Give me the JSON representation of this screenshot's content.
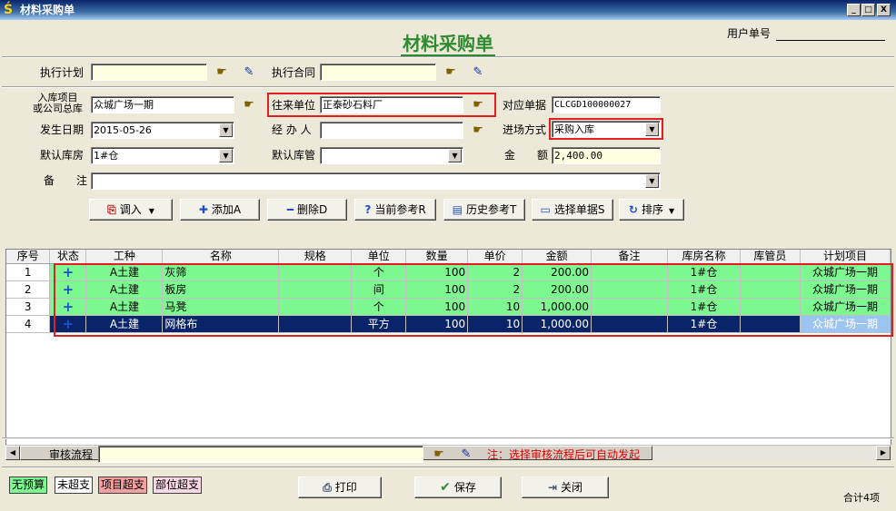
{
  "window": {
    "title": "材料采购单",
    "min": "_",
    "max": "□",
    "close": "X"
  },
  "heading": "材料采购单",
  "user_no_label": "用户单号",
  "row1": {
    "plan_label": "执行计划",
    "plan_value": "",
    "contract_label": "执行合同",
    "contract_value": ""
  },
  "fields": {
    "project_label": "入库项目\n或公司总库",
    "project_value": "众城广场一期",
    "partner_label": "往来单位",
    "partner_value": "正泰砂石料厂",
    "docno_label": "对应单据",
    "docno_value": "CLCGD100000027",
    "date_label": "发生日期",
    "date_value": "2015-05-26",
    "handler_label": "经 办 人",
    "handler_value": "",
    "mode_label": "进场方式",
    "mode_value": "采购入库",
    "warehouse_label": "默认库房",
    "warehouse_value": "1#仓",
    "keeper_label": "默认库管",
    "keeper_value": "",
    "amount_label": "金　　额",
    "amount_value": "2,400.00",
    "remark_label": "备　　注",
    "remark_value": ""
  },
  "toolbar": {
    "import": "调入",
    "add": "添加A",
    "delete": "删除D",
    "current_ref": "当前参考R",
    "history_ref": "历史参考T",
    "select_doc": "选择单据S",
    "sort": "排序"
  },
  "table": {
    "columns": [
      "序号",
      "状态",
      "工种",
      "名称",
      "规格",
      "单位",
      "数量",
      "单价",
      "金额",
      "备注",
      "库房名称",
      "库管员",
      "计划项目"
    ],
    "rows": [
      {
        "no": "1",
        "status": "+",
        "trade": "A土建",
        "name": "灰筛",
        "spec": "",
        "unit": "个",
        "qty": "100",
        "price": "2",
        "amount": "200.00",
        "remark": "",
        "wh": "1#仓",
        "keeper": "",
        "plan": "众城广场一期"
      },
      {
        "no": "2",
        "status": "+",
        "trade": "A土建",
        "name": "板房",
        "spec": "",
        "unit": "间",
        "qty": "100",
        "price": "2",
        "amount": "200.00",
        "remark": "",
        "wh": "1#仓",
        "keeper": "",
        "plan": "众城广场一期"
      },
      {
        "no": "3",
        "status": "+",
        "trade": "A土建",
        "name": "马凳",
        "spec": "",
        "unit": "个",
        "qty": "100",
        "price": "10",
        "amount": "1,000.00",
        "remark": "",
        "wh": "1#仓",
        "keeper": "",
        "plan": "众城广场一期"
      },
      {
        "no": "4",
        "status": "+",
        "trade": "A土建",
        "name": "网格布",
        "spec": "",
        "unit": "平方",
        "qty": "100",
        "price": "10",
        "amount": "1,000.00",
        "remark": "",
        "wh": "1#仓",
        "keeper": "",
        "plan": "众城广场一期"
      }
    ]
  },
  "approval": {
    "label": "审核流程",
    "value": "",
    "note": "注：选择审核流程后可自动发起"
  },
  "legend": {
    "no_budget": "无预算",
    "not_over": "未超支",
    "project_over": "项目超支",
    "part_over": "部位超支"
  },
  "buttons": {
    "print": "打印",
    "save": "保存",
    "close": "关闭"
  },
  "total": "合计4项",
  "colors": {
    "green_row": "#7DF78F",
    "selected_row": "#0A246A",
    "highlight": "#E02020",
    "heading": "#2E8B2E"
  }
}
